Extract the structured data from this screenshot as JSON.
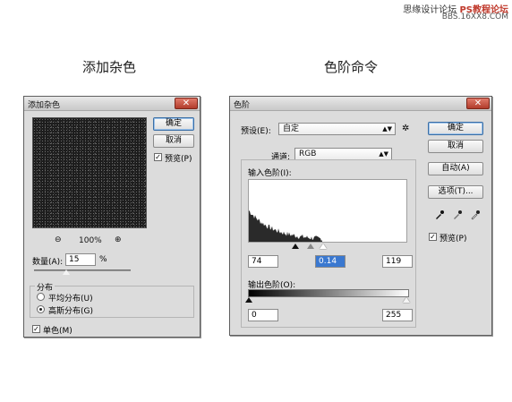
{
  "watermark": {
    "text_cn": "思缘设计论坛",
    "text_brand": "PS教程论坛",
    "url": "BBS.16XX8.COM"
  },
  "captions": {
    "left": "添加杂色",
    "right": "色阶命令"
  },
  "noise_dialog": {
    "title": "添加杂色",
    "close_label": "✕",
    "ok_label": "确定",
    "cancel_label": "取消",
    "preview_checkbox": {
      "label": "预览(P)",
      "checked": true
    },
    "zoom_out_icon": "⊖",
    "zoom_level": "100%",
    "zoom_in_icon": "⊕",
    "amount_label": "数量(A):",
    "amount_value": "15",
    "amount_unit": "%",
    "amount_fraction": 0.15,
    "distribution": {
      "legend": "分布",
      "options": [
        {
          "label": "平均分布(U)",
          "selected": false
        },
        {
          "label": "高斯分布(G)",
          "selected": true
        }
      ]
    },
    "mono_checkbox": {
      "label": "单色(M)",
      "checked": true
    }
  },
  "levels_dialog": {
    "title": "色阶",
    "close_label": "✕",
    "preset_label": "预设(E):",
    "preset_value": "自定",
    "gear_icon": "✲",
    "channel_label": "通道:",
    "channel_value": "RGB",
    "input_levels_label": "输入色阶(I):",
    "input_values": {
      "black": "74",
      "gray": "0.14",
      "white": "119"
    },
    "output_levels_label": "输出色阶(O):",
    "output_values": {
      "black": "0",
      "white": "255"
    },
    "ok_label": "确定",
    "cancel_label": "取消",
    "auto_label": "自动(A)",
    "options_label": "选项(T)...",
    "preview_checkbox": {
      "label": "预览(P)",
      "checked": true
    },
    "histogram_fill": "#2a2a2a"
  }
}
